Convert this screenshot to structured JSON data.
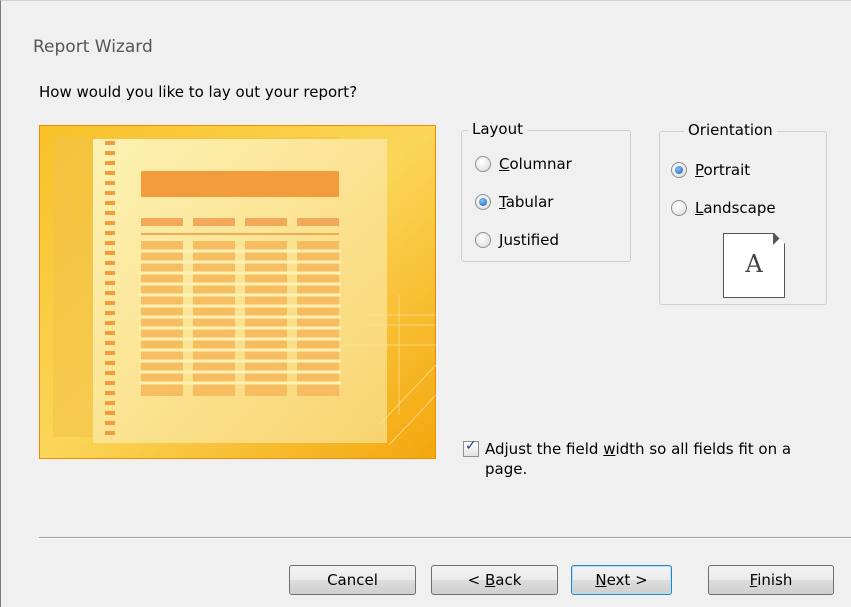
{
  "window": {
    "title": "Report Wizard"
  },
  "question": "How would you like to lay out your report?",
  "layout_group": {
    "legend": "Layout",
    "options": [
      {
        "pre": "",
        "key": "C",
        "post": "olumnar",
        "selected": false
      },
      {
        "pre": "",
        "key": "T",
        "post": "abular",
        "selected": true
      },
      {
        "pre": "",
        "key": "J",
        "post": "ustified",
        "selected": false
      }
    ]
  },
  "orientation_group": {
    "legend": "Orientation",
    "options": [
      {
        "pre": "",
        "key": "P",
        "post": "ortrait",
        "selected": true
      },
      {
        "pre": "",
        "key": "L",
        "post": "andscape",
        "selected": false
      }
    ],
    "page_letter": "A"
  },
  "adjust_checkbox": {
    "checked": true,
    "pre": "Adjust the field ",
    "key": "w",
    "post": "idth so all fields fit on a page."
  },
  "buttons": {
    "cancel": {
      "pre": "Cancel",
      "key": "",
      "post": ""
    },
    "back": {
      "pre": "< ",
      "key": "B",
      "post": "ack"
    },
    "next": {
      "pre": "",
      "key": "N",
      "post": "ext >"
    },
    "finish": {
      "pre": "",
      "key": "F",
      "post": "inish"
    }
  },
  "colors": {
    "preview_orange": "#f6a800",
    "preview_bar": "#f39c3c",
    "accent_blue": "#1c5fa8"
  }
}
